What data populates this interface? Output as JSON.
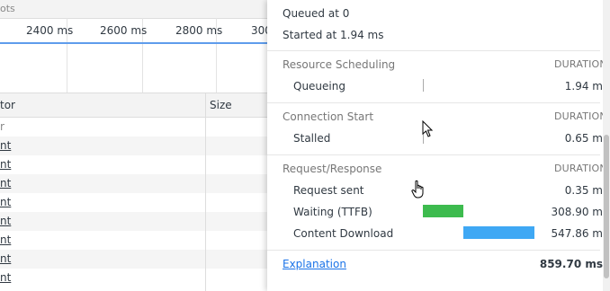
{
  "toolbar": {
    "partial_label": "ots"
  },
  "timeline": {
    "ticks": [
      "2400 ms",
      "2600 ms",
      "2800 ms",
      "300"
    ]
  },
  "table": {
    "headers": {
      "initiator": "tor",
      "size": "Size"
    },
    "first_row": "r",
    "rows": [
      "nt",
      "nt",
      "nt",
      "nt",
      "nt",
      "nt",
      "nt",
      "nt"
    ]
  },
  "timing": {
    "queued_at": "Queued at 0",
    "started_at": "Started at 1.94 ms",
    "duration_label": "DURATION",
    "sections": [
      {
        "title": "Resource Scheduling",
        "rows": [
          {
            "label": "Queueing",
            "value": "1.94 m"
          }
        ]
      },
      {
        "title": "Connection Start",
        "rows": [
          {
            "label": "Stalled",
            "value": "0.65 m"
          }
        ]
      },
      {
        "title": "Request/Response",
        "rows": [
          {
            "label": "Request sent",
            "value": "0.35 m"
          },
          {
            "label": "Waiting (TTFB)",
            "value": "308.90 m"
          },
          {
            "label": "Content Download",
            "value": "547.86 m"
          }
        ]
      }
    ],
    "explanation_link": "Explanation",
    "total": "859.70 ms",
    "colors": {
      "ttfb": "#3dbb4e",
      "download": "#3fa8f4"
    }
  }
}
